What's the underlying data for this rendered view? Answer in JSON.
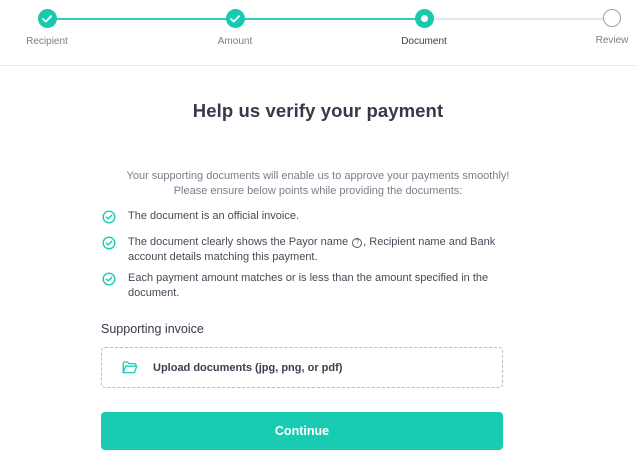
{
  "stepper": {
    "steps": [
      {
        "label": "Recipient",
        "state": "done"
      },
      {
        "label": "Amount",
        "state": "done"
      },
      {
        "label": "Document",
        "state": "current"
      },
      {
        "label": "Review",
        "state": "todo"
      }
    ]
  },
  "main": {
    "title": "Help us verify your payment",
    "intro_line1": "Your supporting documents will enable us to approve your payments smoothly!",
    "intro_line2": "Please ensure below points while providing the documents:",
    "points": [
      {
        "text": "The document is an official invoice."
      },
      {
        "text_before": "The document clearly shows the Payor name",
        "help_glyph": "?",
        "text_after": ", Recipient name and Bank account details matching this payment."
      },
      {
        "text": "Each payment amount matches or is less than the amount specified in the document."
      }
    ],
    "section_label": "Supporting invoice",
    "upload_label": "Upload documents (jpg, png, or pdf)",
    "continue_label": "Continue"
  },
  "colors": {
    "accent": "#19cbb1",
    "text_primary": "#353a48",
    "text_secondary": "#7a7f8a",
    "border": "#b7bcc5"
  },
  "icons": {
    "done_step": "check-icon",
    "current_step": "dot-icon",
    "point": "check-circle-icon",
    "upload": "folder-open-icon"
  }
}
